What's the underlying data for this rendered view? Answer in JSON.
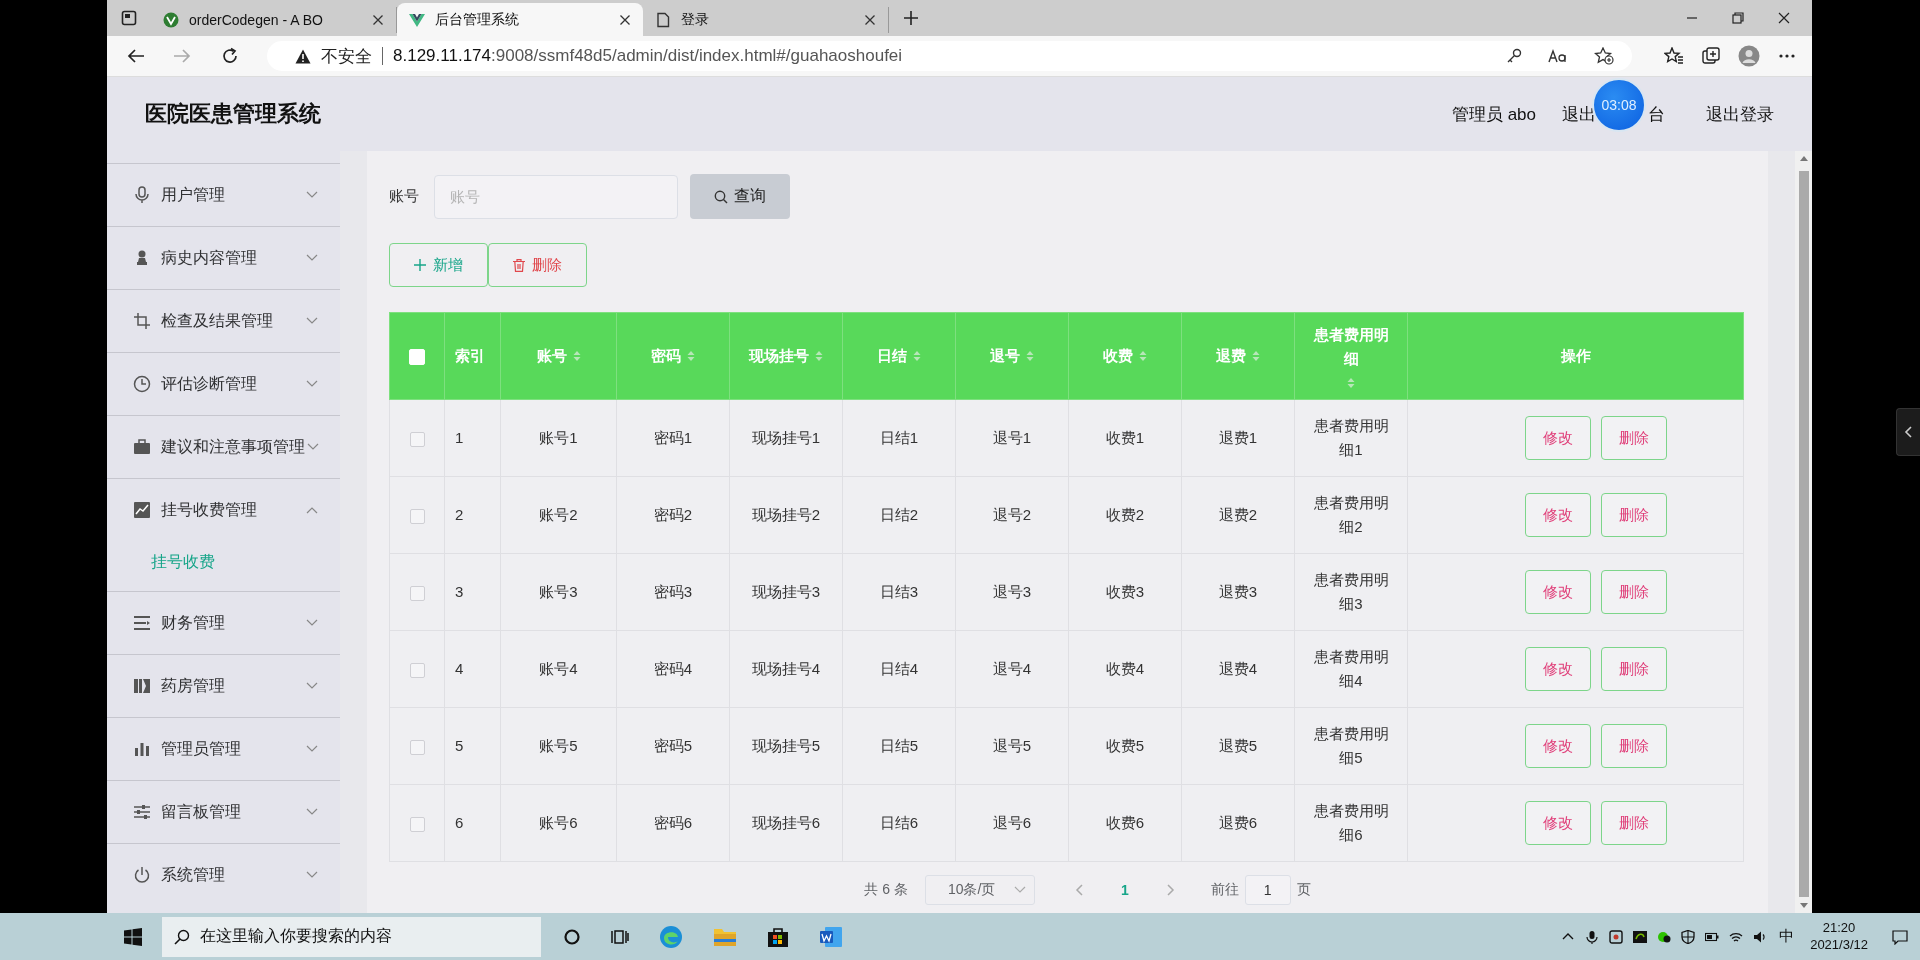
{
  "browser": {
    "tabs": [
      {
        "title": "orderCodegen - A BO",
        "selected": false,
        "kind": "vue"
      },
      {
        "title": "后台管理系统",
        "selected": true,
        "kind": "vue"
      },
      {
        "title": "登录",
        "selected": false,
        "kind": "page"
      }
    ],
    "security": "不安全",
    "url_host": "8.129.11.174",
    "url_rest": ":9008/ssmf48d5/admin/dist/index.html#/guahaoshoufei"
  },
  "header": {
    "title": "医院医患管理系统",
    "user": "管理员 abo",
    "front_link_start": "退出",
    "front_link_end": "台",
    "logout": "退出登录",
    "timer": "03:08"
  },
  "sidebar": {
    "items": [
      {
        "label": "用户管理",
        "expanded": false
      },
      {
        "label": "病史内容管理",
        "expanded": false
      },
      {
        "label": "检查及结果管理",
        "expanded": false
      },
      {
        "label": "评估诊断管理",
        "expanded": false
      },
      {
        "label": "建议和注意事项管理",
        "expanded": false
      },
      {
        "label": "挂号收费管理",
        "expanded": true,
        "children": [
          {
            "label": "挂号收费",
            "selected": true
          }
        ]
      },
      {
        "label": "财务管理",
        "expanded": false
      },
      {
        "label": "药房管理",
        "expanded": false
      },
      {
        "label": "管理员管理",
        "expanded": false
      },
      {
        "label": "留言板管理",
        "expanded": false
      },
      {
        "label": "系统管理",
        "expanded": false
      }
    ]
  },
  "search": {
    "label": "账号",
    "placeholder": "账号",
    "button": "查询"
  },
  "actions": {
    "add": "新增",
    "delete": "删除"
  },
  "table": {
    "select_all_checked": false,
    "columns": [
      {
        "label": "索引",
        "sortable": false
      },
      {
        "label": "账号",
        "sortable": true
      },
      {
        "label": "密码",
        "sortable": true
      },
      {
        "label": "现场挂号",
        "sortable": true
      },
      {
        "label": "日结",
        "sortable": true
      },
      {
        "label": "退号",
        "sortable": true
      },
      {
        "label": "收费",
        "sortable": true
      },
      {
        "label": "退费",
        "sortable": true
      },
      {
        "label": "患者费用明细",
        "sortable": true
      },
      {
        "label": "操作",
        "sortable": false
      }
    ],
    "rows": [
      {
        "checked": false,
        "cells": [
          "1",
          "账号1",
          "密码1",
          "现场挂号1",
          "日结1",
          "退号1",
          "收费1",
          "退费1",
          "患者费用明细1"
        ],
        "edit": "修改",
        "delete": "删除"
      },
      {
        "checked": false,
        "cells": [
          "2",
          "账号2",
          "密码2",
          "现场挂号2",
          "日结2",
          "退号2",
          "收费2",
          "退费2",
          "患者费用明细2"
        ],
        "edit": "修改",
        "delete": "删除"
      },
      {
        "checked": false,
        "cells": [
          "3",
          "账号3",
          "密码3",
          "现场挂号3",
          "日结3",
          "退号3",
          "收费3",
          "退费3",
          "患者费用明细3"
        ],
        "edit": "修改",
        "delete": "删除"
      },
      {
        "checked": false,
        "cells": [
          "4",
          "账号4",
          "密码4",
          "现场挂号4",
          "日结4",
          "退号4",
          "收费4",
          "退费4",
          "患者费用明细4"
        ],
        "edit": "修改",
        "delete": "删除"
      },
      {
        "checked": false,
        "cells": [
          "5",
          "账号5",
          "密码5",
          "现场挂号5",
          "日结5",
          "退号5",
          "收费5",
          "退费5",
          "患者费用明细5"
        ],
        "edit": "修改",
        "delete": "删除"
      },
      {
        "checked": false,
        "cells": [
          "6",
          "账号6",
          "密码6",
          "现场挂号6",
          "日结6",
          "退号6",
          "收费6",
          "退费6",
          "患者费用明细6"
        ],
        "edit": "修改",
        "delete": "删除"
      }
    ]
  },
  "pagination": {
    "total": "共 6 条",
    "page_size": "10条/页",
    "pages": [
      {
        "label": "1",
        "selected": true
      }
    ],
    "goto_label": "前往",
    "goto_value": "1",
    "goto_suffix": "页"
  },
  "taskbar": {
    "search_placeholder": "在这里输入你要搜索的内容",
    "ime": "中",
    "time": "21:20",
    "date": "2021/3/12"
  }
}
